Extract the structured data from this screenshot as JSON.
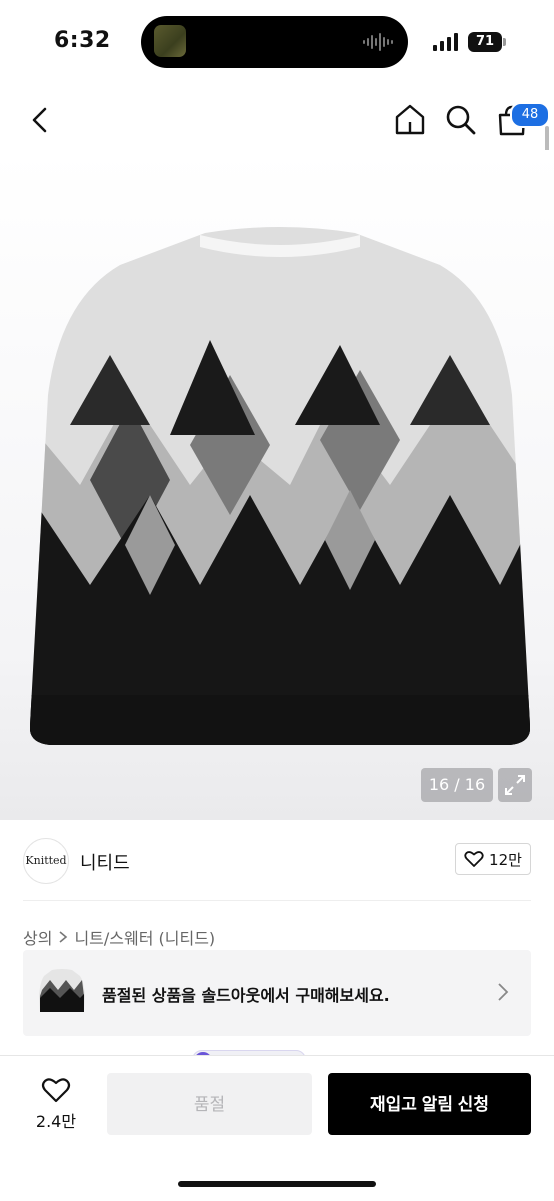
{
  "status_bar": {
    "time": "6:32",
    "battery": "71"
  },
  "nav": {
    "cart_count": "48"
  },
  "gallery": {
    "counter": "16 / 16"
  },
  "brand": {
    "logo_text": "Knitted",
    "name": "니티드",
    "likes": "12만"
  },
  "breadcrumb": {
    "category": "상의",
    "subcategory": "니트/스웨터 (니티드)"
  },
  "soldout_banner": {
    "text": "품절된 상품을 솔드아웃에서 구매해보세요."
  },
  "bottom_bar": {
    "wish_count": "2.4만",
    "soldout_label": "품절",
    "restock_label": "재입고 알림 신청"
  },
  "icons": [
    "back-icon",
    "home-icon",
    "search-icon",
    "cart-icon",
    "expand-icon",
    "heart-icon",
    "chevron-right-icon",
    "signal-icon",
    "voice-wave-icon"
  ],
  "colors": {
    "accent_blue": "#1d6fe3",
    "restock_button": "#000000",
    "soldout_button": "#f1f1f2"
  }
}
